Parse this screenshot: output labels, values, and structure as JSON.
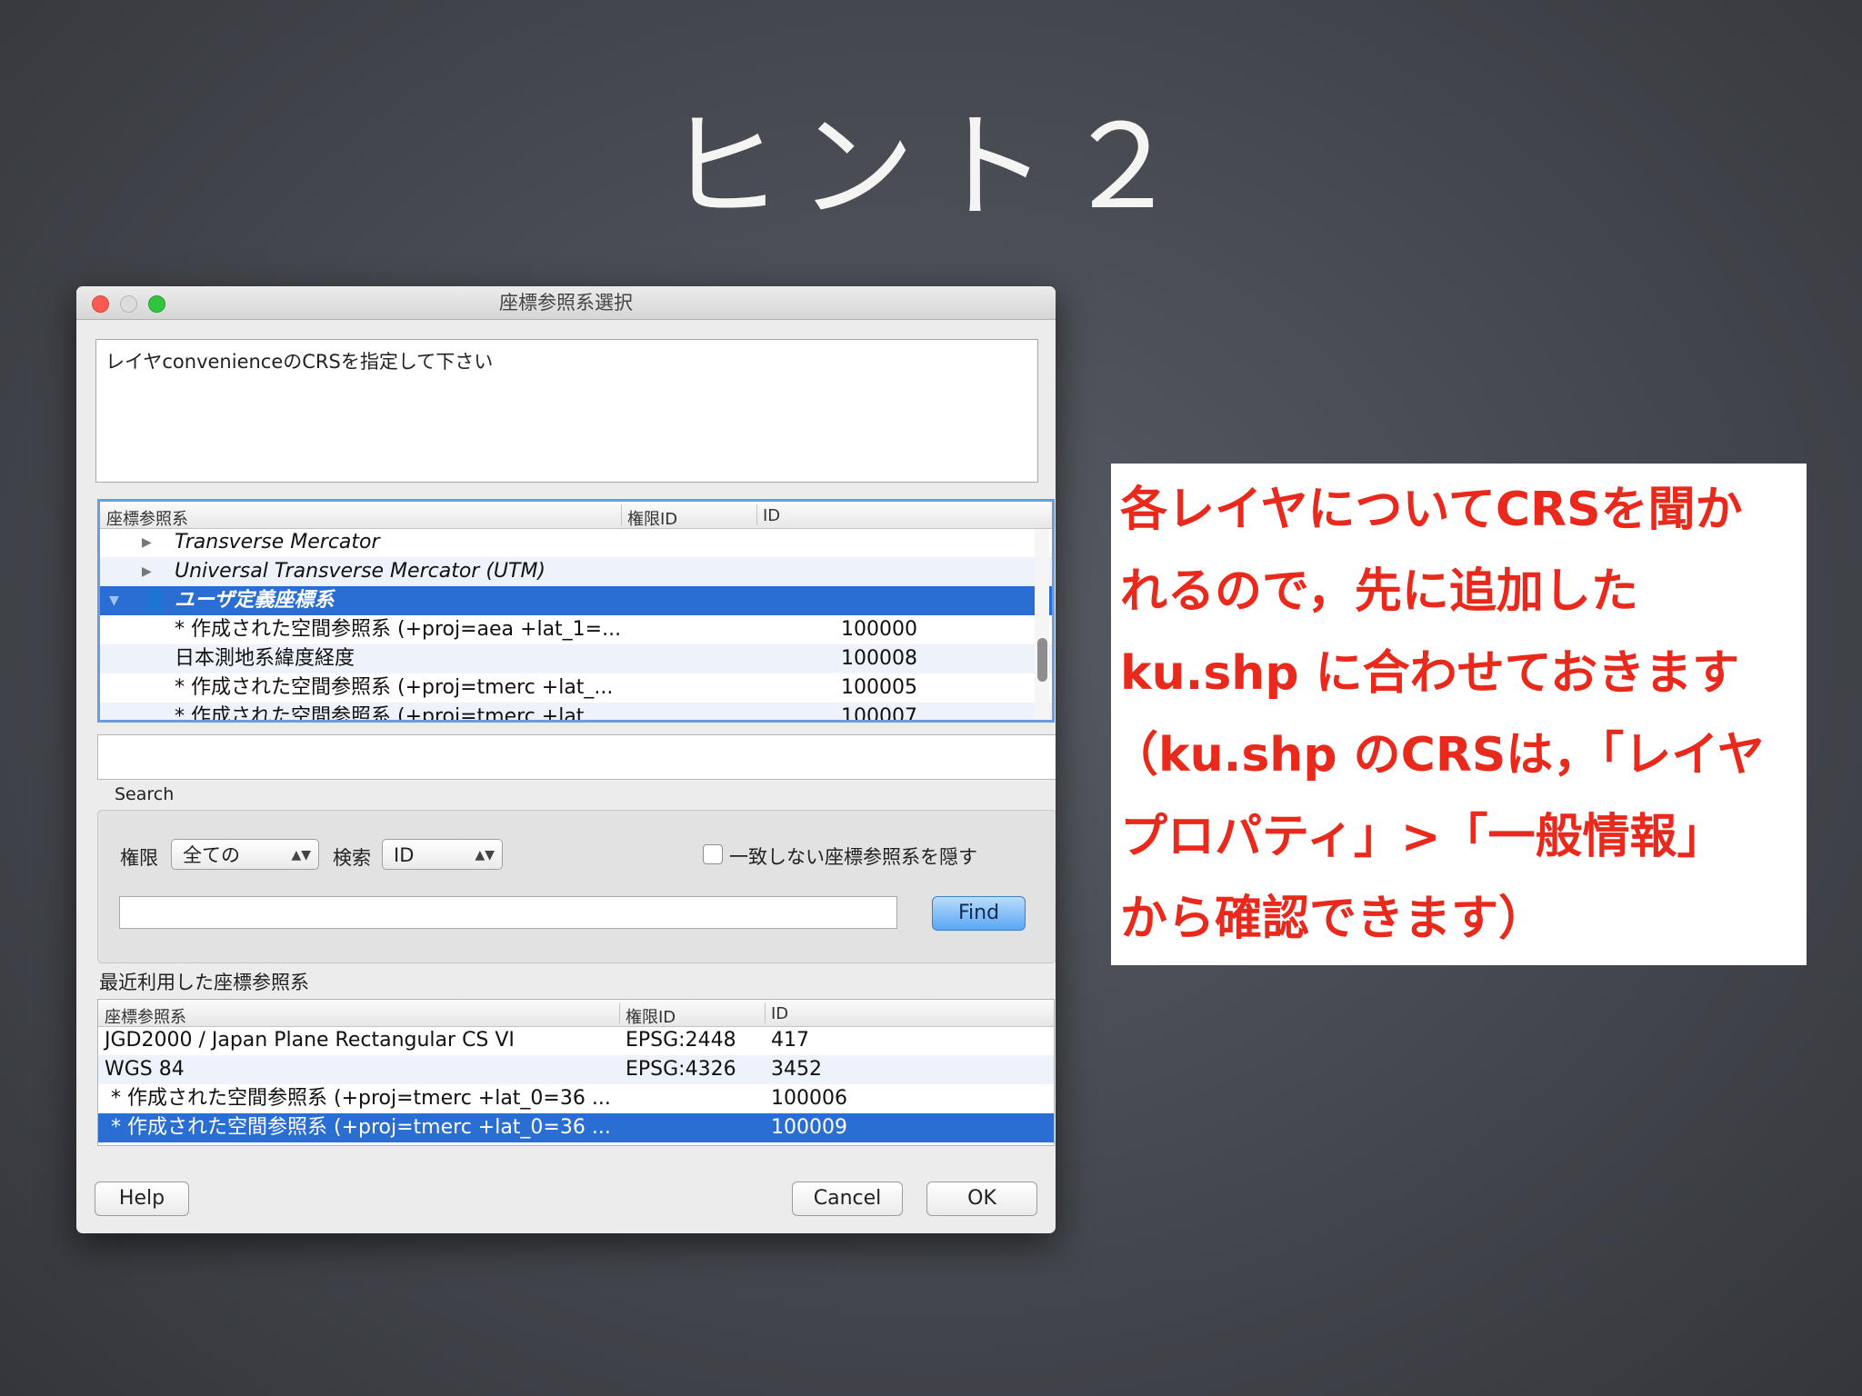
{
  "slide": {
    "title": "ヒント２"
  },
  "dialog": {
    "title": "座標参照系選択",
    "message": "レイヤconvenienceのCRSを指定して下さい",
    "tree": {
      "headers": [
        "座標参照系",
        "権限ID",
        "ID"
      ],
      "rows": [
        {
          "name": "Transverse Mercator",
          "auth": "",
          "id": ""
        },
        {
          "name": "Universal Transverse Mercator (UTM)",
          "auth": "",
          "id": ""
        },
        {
          "name": "ユーザ定義座標系",
          "auth": "",
          "id": ""
        },
        {
          "name": "* 作成された空間参照系 (+proj=aea +lat_1=...",
          "auth": "",
          "id": "100000"
        },
        {
          "name": "日本測地系緯度経度",
          "auth": "",
          "id": "100008"
        },
        {
          "name": "* 作成された空間参照系 (+proj=tmerc +lat_...",
          "auth": "",
          "id": "100005"
        },
        {
          "name": "* 作成された空間参照系 (+proj=tmerc +lat_...",
          "auth": "",
          "id": "100007"
        }
      ]
    },
    "search": {
      "label": "Search",
      "authority_label": "権限",
      "authority_value": "全ての",
      "search_by_label": "検索",
      "search_by_value": "ID",
      "hide_checkbox_label": "一致しない座標参照系を隠す",
      "find_label": "Find",
      "query": ""
    },
    "recent": {
      "label": "最近利用した座標参照系",
      "headers": [
        "座標参照系",
        "権限ID",
        "ID"
      ],
      "rows": [
        {
          "name": "JGD2000 / Japan Plane Rectangular CS VI",
          "auth": "EPSG:2448",
          "id": "417"
        },
        {
          "name": "WGS 84",
          "auth": "EPSG:4326",
          "id": "3452"
        },
        {
          "name": "* 作成された空間参照系 (+proj=tmerc +lat_0=36 ...",
          "auth": "",
          "id": "100006"
        },
        {
          "name": "* 作成された空間参照系 (+proj=tmerc +lat_0=36 ...",
          "auth": "",
          "id": "100009"
        }
      ]
    },
    "buttons": {
      "help": "Help",
      "cancel": "Cancel",
      "ok": "OK"
    }
  },
  "callout": {
    "lines": [
      "各レイヤについてCRSを聞か",
      "れるので，先に追加した",
      "ku.shp に合わせておきます",
      "（ku.shp のCRSは，「レイヤ",
      "プロパティ」>「一般情報」",
      "から確認できます）"
    ]
  },
  "colors": {
    "callout_text": "#e8291c",
    "selection": "#2a6ed3",
    "find_button": "#5aa6f4"
  }
}
